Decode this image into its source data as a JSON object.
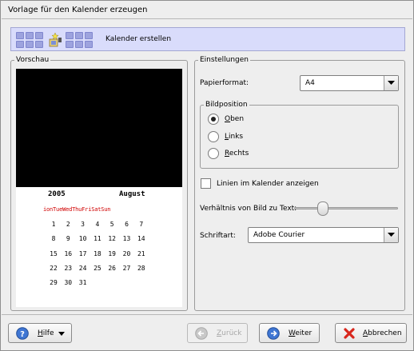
{
  "window": {
    "title": "Vorlage für den Kalender erzeugen"
  },
  "banner": {
    "title": "Kalender erstellen"
  },
  "preview": {
    "legend": "Vorschau",
    "calendar": {
      "year": "2005",
      "month": "August",
      "weekdays": "ionTueWedThuFriSatSun",
      "days": [
        "1",
        "2",
        "3",
        "4",
        "5",
        "6",
        "7",
        "8",
        "9",
        "10",
        "11",
        "12",
        "13",
        "14",
        "15",
        "16",
        "17",
        "18",
        "19",
        "20",
        "21",
        "22",
        "23",
        "24",
        "25",
        "26",
        "27",
        "28",
        "29",
        "30",
        "31"
      ]
    }
  },
  "settings": {
    "legend": "Einstellungen",
    "paper_label": "Papierformat:",
    "paper_value": "A4",
    "position": {
      "legend": "Bildposition",
      "options": [
        {
          "label": "Oben",
          "selected": true
        },
        {
          "label": "Links",
          "selected": false
        },
        {
          "label": "Rechts",
          "selected": false
        }
      ]
    },
    "lines_label": "Linien im Kalender anzeigen",
    "lines_checked": false,
    "ratio_label": "Verhältnis von Bild zu Text:",
    "ratio_value": 0.25,
    "font_label": "Schriftart:",
    "font_value": "Adobe Courier"
  },
  "buttons": {
    "help": "Hilfe",
    "back": "Zurück",
    "next": "Weiter",
    "cancel": "Abbrechen"
  }
}
